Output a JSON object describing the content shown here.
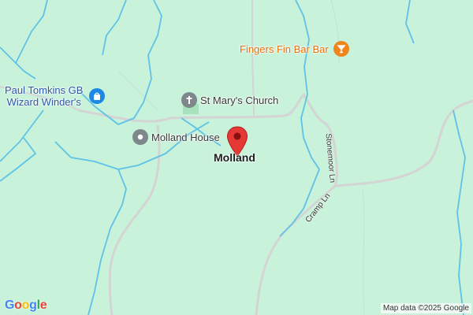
{
  "pois": {
    "bar": {
      "label": "Fingers Fin Bar Bar",
      "color": "#e8700a"
    },
    "church": {
      "label": "St Mary's Church",
      "color": "#6f7a80"
    },
    "house": {
      "label": "Molland House",
      "color": "#6f7a80"
    },
    "shop": {
      "label": "Paul Tomkins GB Wizard Winder's",
      "line1": "Paul Tomkins GB",
      "line2": "Wizard Winder's",
      "color": "#1e88e5"
    }
  },
  "place": {
    "label": "Molland"
  },
  "roads": {
    "stonemoor": "Stonemoor Ln",
    "cramp": "Cramp Ln"
  },
  "attribution": "Map data ©2025 Google",
  "logo": {
    "text": "Google",
    "letters": [
      "G",
      "o",
      "o",
      "g",
      "l",
      "e"
    ]
  },
  "colors": {
    "background": "#c8f2da",
    "water": "#5ec3e6",
    "road": "#d9d9d9",
    "marker": "#e53935"
  }
}
